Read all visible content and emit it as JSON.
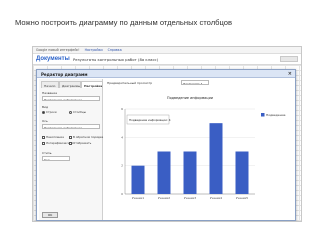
{
  "slide": {
    "title": "Можно построить диаграмму по данным отдельных столбцов"
  },
  "app": {
    "topbar_text": "Google новый интерфейс!",
    "topbar_links": [
      "Настройки",
      "Справка"
    ],
    "logo": "Документы",
    "doc_title": "Результаты контрольных работ (8а класс)",
    "chart_editor": {
      "title": "Редактор диаграмм",
      "tabs": [
        "Начало",
        "Диаграммы",
        "Настройки"
      ],
      "active_tab": 2,
      "sections": {
        "title_label": "Название",
        "title_value": "Подведение информации",
        "direction_label": "Вид",
        "options": [
          "Строки",
          "Столбцы"
        ],
        "legend_label": "Ось",
        "legend_value": "Подведение информации",
        "checkboxes": [
          "Накопление",
          "В обратном порядке",
          "Логарифмическая",
          "Отображать"
        ],
        "size_label": "Стиль",
        "size_value": "Код"
      },
      "preview_label": "Предварительный просмотр",
      "preview_select": "Диаграмма А",
      "ok_label": "OK"
    }
  },
  "chart_data": {
    "type": "bar",
    "title": "Подведение информации",
    "categories": [
      "Ученик1",
      "Ученик2",
      "Ученик3",
      "Ученик4",
      "Ученик5"
    ],
    "series": [
      {
        "name": "Подведение",
        "values": [
          2,
          3,
          3,
          5,
          3
        ]
      }
    ],
    "ylim": [
      0,
      6
    ],
    "tooltip": "Подведение информации: 4",
    "legend": "right",
    "color": "#3a5ec4"
  }
}
